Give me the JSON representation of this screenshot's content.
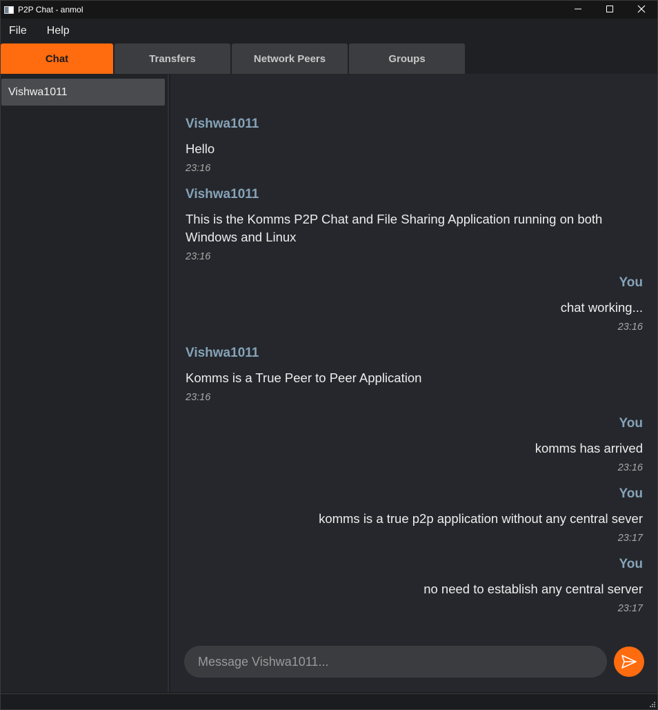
{
  "window": {
    "title": "P2P Chat - anmol"
  },
  "menu": {
    "items": [
      "File",
      "Help"
    ]
  },
  "tabs": [
    {
      "label": "Chat",
      "active": true
    },
    {
      "label": "Transfers",
      "active": false
    },
    {
      "label": "Network Peers",
      "active": false
    },
    {
      "label": "Groups",
      "active": false
    }
  ],
  "sidebar": {
    "contacts": [
      {
        "name": "Vishwa1011",
        "selected": true
      }
    ]
  },
  "chat": {
    "messages": [
      {
        "sender": "Vishwa1011",
        "text": "Hello",
        "time": "23:16",
        "outgoing": false
      },
      {
        "sender": "Vishwa1011",
        "text": "This is the Komms P2P Chat and File Sharing Application running on both Windows and Linux",
        "time": "23:16",
        "outgoing": false
      },
      {
        "sender": "You",
        "text": "chat working...",
        "time": "23:16",
        "outgoing": true
      },
      {
        "sender": "Vishwa1011",
        "text": "Komms is a True Peer to Peer Application",
        "time": "23:16",
        "outgoing": false
      },
      {
        "sender": "You",
        "text": "komms has arrived",
        "time": "23:16",
        "outgoing": true
      },
      {
        "sender": "You",
        "text": "komms is a true p2p application without any central sever",
        "time": "23:17",
        "outgoing": true
      },
      {
        "sender": "You",
        "text": "no need to establish any central server",
        "time": "23:17",
        "outgoing": true
      }
    ]
  },
  "composer": {
    "placeholder": "Message Vishwa1011...",
    "value": ""
  },
  "icons": {
    "app": "app-window-icon",
    "minimize": "minimize-icon",
    "maximize": "maximize-icon",
    "close": "close-icon",
    "send": "send-icon",
    "grip": "resize-grip-icon"
  },
  "colors": {
    "accent": "#ff6b0f",
    "sender": "#86a3b8",
    "chat_bg": "#25272c",
    "sidebar_bg": "#222327",
    "selected_contact": "#4a4b4e",
    "inactive_tab": "#3b3d40"
  }
}
